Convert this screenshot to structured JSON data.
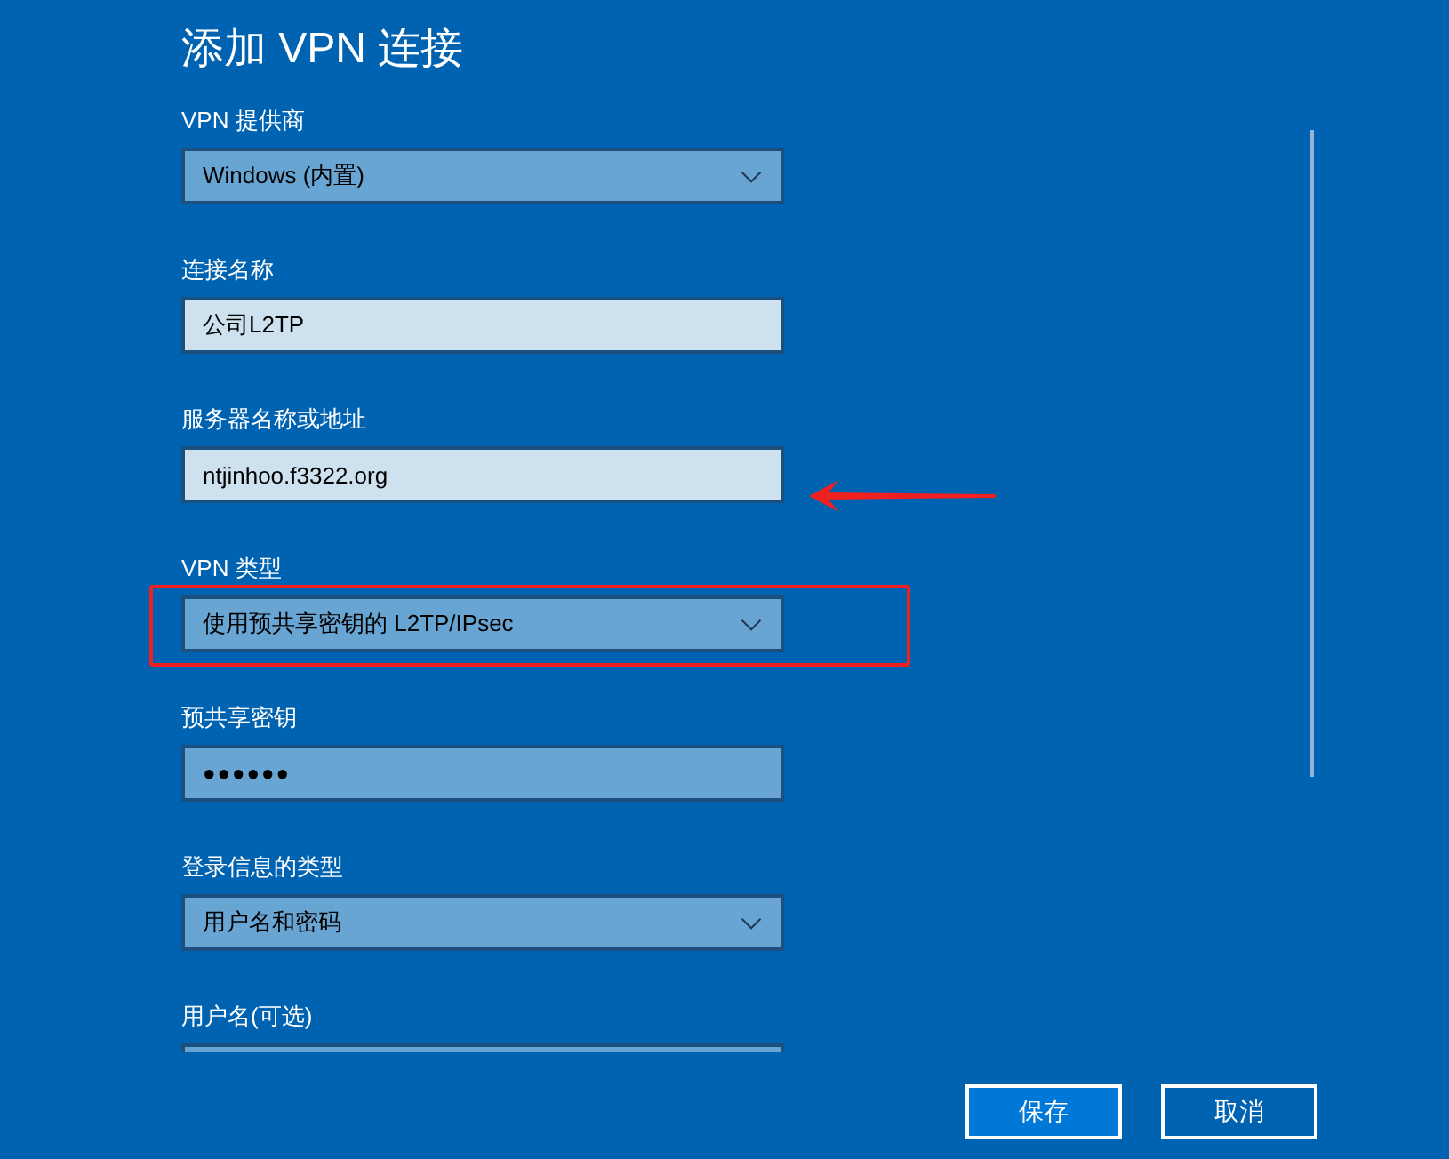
{
  "title": "添加 VPN 连接",
  "fields": [
    {
      "label": "VPN 提供商",
      "kind": "dropdown",
      "value": "Windows (内置)",
      "highlighted": false
    },
    {
      "label": "连接名称",
      "kind": "text",
      "value": "公司L2TP",
      "highlighted": true
    },
    {
      "label": "服务器名称或地址",
      "kind": "text",
      "value": "ntjinhoo.f3322.org",
      "highlighted": true
    },
    {
      "label": "VPN 类型",
      "kind": "dropdown",
      "value": "使用预共享密钥的 L2TP/IPsec",
      "highlighted": false
    },
    {
      "label": "预共享密钥",
      "kind": "password",
      "value": "●●●●●●",
      "highlighted": false
    },
    {
      "label": "登录信息的类型",
      "kind": "dropdown",
      "value": "用户名和密码",
      "highlighted": false
    },
    {
      "label": "用户名(可选)",
      "kind": "text",
      "highlighted": false
    }
  ],
  "buttons": [
    {
      "label": "保存",
      "primary": true
    },
    {
      "label": "取消",
      "primary": false
    }
  ]
}
